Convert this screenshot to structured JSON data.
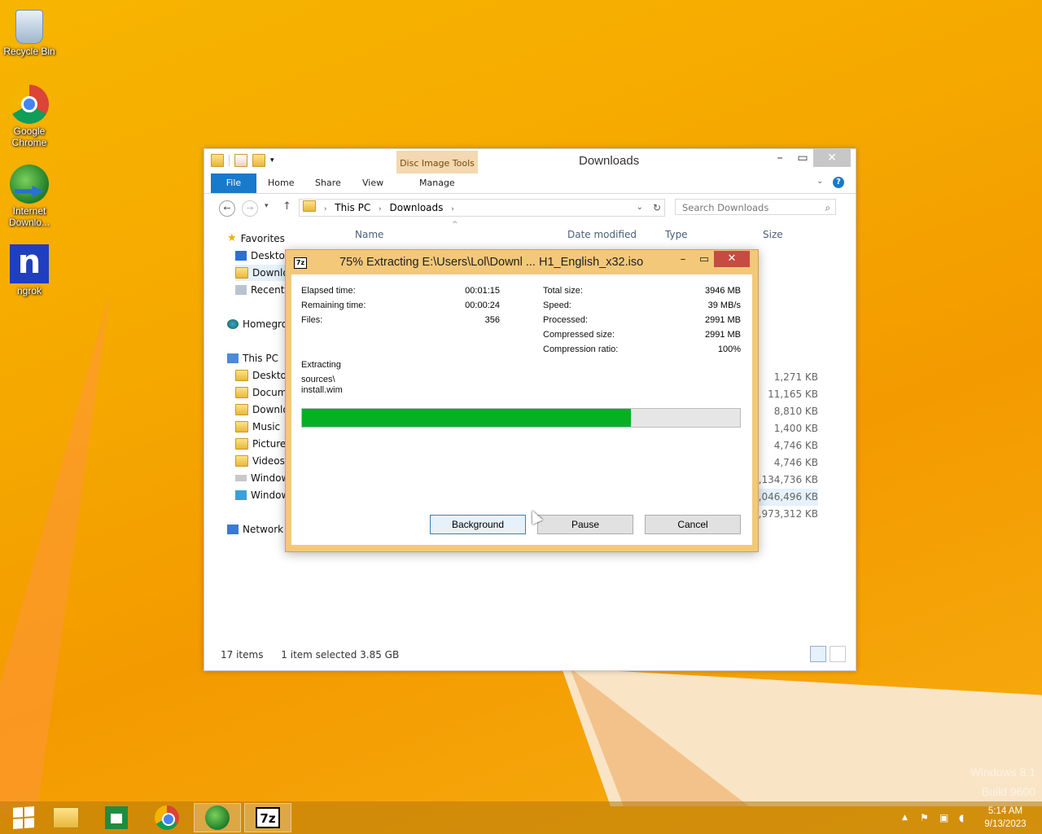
{
  "desktop": {
    "icons": [
      {
        "label": "Recycle Bin"
      },
      {
        "label": "Google Chrome"
      },
      {
        "label": "Internet Downlo..."
      },
      {
        "label": "ngrok"
      }
    ],
    "watermark_line1": "Windows 8.1",
    "watermark_line2": "Build 9600"
  },
  "explorer": {
    "title": "Downloads",
    "context_tab": "Disc Image Tools",
    "ribbon_tabs": [
      "File",
      "Home",
      "Share",
      "View",
      "Manage"
    ],
    "breadcrumb": [
      "This PC",
      "Downloads"
    ],
    "search_placeholder": "Search Downloads",
    "columns": [
      "Name",
      "Date modified",
      "Type",
      "Size"
    ],
    "nav": {
      "favorites": "Favorites",
      "fav_items": [
        "Desktop",
        "Downlo",
        "Recent p"
      ],
      "homegroup": "Homegro",
      "thispc": "This PC",
      "pc_items": [
        "Desktop",
        "Docume",
        "Downlo",
        "Music",
        "Pictures",
        "Videos",
        "Window",
        "Window"
      ],
      "network": "Network"
    },
    "sizes": [
      "1,271 KB",
      "11,165 KB",
      "8,810 KB",
      "1,400 KB",
      "4,746 KB",
      "4,746 KB",
      "3,134,736 KB",
      "4,046,496 KB",
      "3,973,312 KB"
    ],
    "status_items": "17 items",
    "status_selected": "1 item selected  3.85 GB"
  },
  "dialog": {
    "title": "75% Extracting E:\\Users\\Lol\\Downl ... H1_English_x32.iso",
    "elapsed_label": "Elapsed time:",
    "elapsed_value": "00:01:15",
    "remaining_label": "Remaining time:",
    "remaining_value": "00:00:24",
    "files_label": "Files:",
    "files_value": "356",
    "total_label": "Total size:",
    "total_value": "3946 MB",
    "speed_label": "Speed:",
    "speed_value": "39 MB/s",
    "processed_label": "Processed:",
    "processed_value": "2991 MB",
    "compressed_label": "Compressed size:",
    "compressed_value": "2991 MB",
    "ratio_label": "Compression ratio:",
    "ratio_value": "100%",
    "status": "Extracting",
    "path_line1": "sources\\",
    "path_line2": "install.wim",
    "progress_percent": 75,
    "buttons": {
      "background": "Background",
      "pause": "Pause",
      "cancel": "Cancel"
    }
  },
  "taskbar": {
    "time": "5:14 AM",
    "date": "9/13/2023"
  },
  "colors": {
    "accent": "#1979ca",
    "progress": "#06b025",
    "dialog_frame": "#f3c879",
    "close": "#c74b43"
  }
}
